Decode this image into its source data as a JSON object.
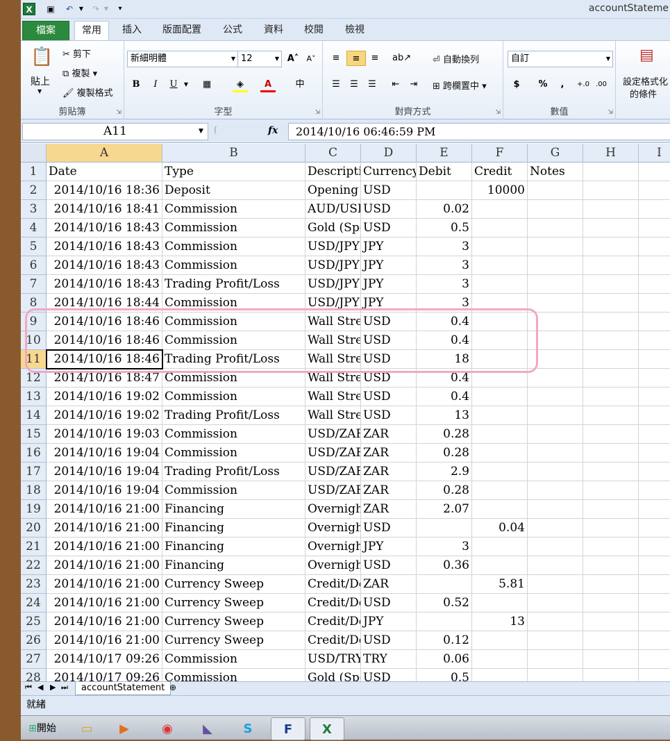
{
  "window": {
    "title": "accountStateme"
  },
  "tabs": {
    "file": "檔案",
    "home": "常用",
    "insert": "插入",
    "layout": "版面配置",
    "formulas": "公式",
    "data": "資料",
    "review": "校閱",
    "view": "檢視"
  },
  "ribbon": {
    "clipboard": {
      "paste": "貼上",
      "cut": "剪下",
      "copy": "複製",
      "format_painter": "複製格式",
      "label": "剪貼簿"
    },
    "font": {
      "name": "新細明體",
      "size": "12",
      "label": "字型"
    },
    "alignment": {
      "wrap": "自動換列",
      "merge": "跨欄置中",
      "label": "對齊方式"
    },
    "number": {
      "format": "自訂",
      "label": "數值"
    },
    "styles": {
      "conditional_line1": "設定格式化",
      "conditional_line2": "的條件"
    }
  },
  "formula_bar": {
    "name_box": "A11",
    "fx": "fx",
    "formula": "2014/10/16  06:46:59 PM"
  },
  "columns": [
    "A",
    "B",
    "C",
    "D",
    "E",
    "F",
    "G",
    "H",
    "I"
  ],
  "rows": [
    [
      "1",
      "Date",
      "Type",
      "Descriptio",
      "Currency",
      "Debit",
      "Credit",
      "Notes"
    ],
    [
      "2",
      "2014/10/16 18:36",
      "Deposit",
      "Opening E",
      "USD",
      "",
      "10000",
      ""
    ],
    [
      "3",
      "2014/10/16 18:41",
      "Commission",
      "AUD/USI",
      "USD",
      "0.02",
      "",
      ""
    ],
    [
      "4",
      "2014/10/16 18:43",
      "Commission",
      "Gold (Spo",
      "USD",
      "0.5",
      "",
      ""
    ],
    [
      "5",
      "2014/10/16 18:43",
      "Commission",
      "USD/JPY",
      "JPY",
      "3",
      "",
      ""
    ],
    [
      "6",
      "2014/10/16 18:43",
      "Commission",
      "USD/JPY",
      "JPY",
      "3",
      "",
      ""
    ],
    [
      "7",
      "2014/10/16 18:43",
      "Trading Profit/Loss",
      "USD/JPY",
      "JPY",
      "3",
      "",
      ""
    ],
    [
      "8",
      "2014/10/16 18:44",
      "Commission",
      "USD/JPY",
      "JPY",
      "3",
      "",
      ""
    ],
    [
      "9",
      "2014/10/16 18:46",
      "Commission",
      "Wall Stree",
      "USD",
      "0.4",
      "",
      ""
    ],
    [
      "10",
      "2014/10/16 18:46",
      "Commission",
      "Wall Stree",
      "USD",
      "0.4",
      "",
      ""
    ],
    [
      "11",
      "2014/10/16 18:46",
      "Trading Profit/Loss",
      "Wall Stree",
      "USD",
      "18",
      "",
      ""
    ],
    [
      "12",
      "2014/10/16 18:47",
      "Commission",
      "Wall Stree",
      "USD",
      "0.4",
      "",
      ""
    ],
    [
      "13",
      "2014/10/16 19:02",
      "Commission",
      "Wall Stree",
      "USD",
      "0.4",
      "",
      ""
    ],
    [
      "14",
      "2014/10/16 19:02",
      "Trading Profit/Loss",
      "Wall Stree",
      "USD",
      "13",
      "",
      ""
    ],
    [
      "15",
      "2014/10/16 19:03",
      "Commission",
      "USD/ZAF",
      "ZAR",
      "0.28",
      "",
      ""
    ],
    [
      "16",
      "2014/10/16 19:04",
      "Commission",
      "USD/ZAF",
      "ZAR",
      "0.28",
      "",
      ""
    ],
    [
      "17",
      "2014/10/16 19:04",
      "Trading Profit/Loss",
      "USD/ZAF",
      "ZAR",
      "2.9",
      "",
      ""
    ],
    [
      "18",
      "2014/10/16 19:04",
      "Commission",
      "USD/ZAF",
      "ZAR",
      "0.28",
      "",
      ""
    ],
    [
      "19",
      "2014/10/16 21:00",
      "Financing",
      "Overnight",
      "ZAR",
      "2.07",
      "",
      ""
    ],
    [
      "20",
      "2014/10/16 21:00",
      "Financing",
      "Overnight",
      "USD",
      "",
      "0.04",
      ""
    ],
    [
      "21",
      "2014/10/16 21:00",
      "Financing",
      "Overnight",
      "JPY",
      "3",
      "",
      ""
    ],
    [
      "22",
      "2014/10/16 21:00",
      "Financing",
      "Overnight",
      "USD",
      "0.36",
      "",
      ""
    ],
    [
      "23",
      "2014/10/16 21:00",
      "Currency Sweep",
      "Credit/Del",
      "ZAR",
      "",
      "5.81",
      ""
    ],
    [
      "24",
      "2014/10/16 21:00",
      "Currency Sweep",
      "Credit/Del",
      "USD",
      "0.52",
      "",
      ""
    ],
    [
      "25",
      "2014/10/16 21:00",
      "Currency Sweep",
      "Credit/Del",
      "JPY",
      "",
      "13",
      ""
    ],
    [
      "26",
      "2014/10/16 21:00",
      "Currency Sweep",
      "Credit/Del",
      "USD",
      "0.12",
      "",
      ""
    ],
    [
      "27",
      "2014/10/17 09:26",
      "Commission",
      "USD/TRY",
      "TRY",
      "0.06",
      "",
      ""
    ],
    [
      "28",
      "2014/10/17 09:26",
      "Commission",
      "Gold (Spo",
      "USD",
      "0.5",
      "",
      ""
    ]
  ],
  "sheet_tab": "accountStatement",
  "status": "就緒",
  "taskbar": {
    "start": "開始"
  },
  "colors": {
    "accent": "#2b8a3e",
    "highlight": "#f0a8c8",
    "selected_header": "#f7d890"
  }
}
